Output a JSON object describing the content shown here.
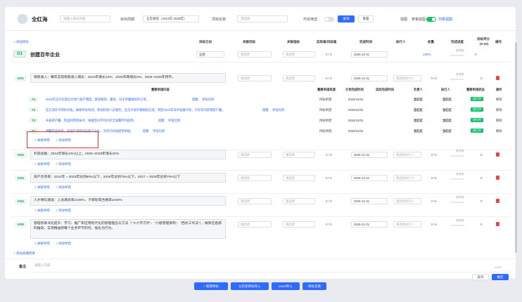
{
  "filter": {
    "user": "全红海",
    "search_placeholder": "请输入目标内容",
    "period_label": "目标周期",
    "period_value": "五年规划（2024年-2028年）",
    "project_label": "项目名称",
    "project_placeholder": "请选择",
    "open_label": "开启筛选",
    "query_btn": "查询",
    "reset_btn": "重置",
    "view_label": "视图",
    "table_view_label": "表格视图",
    "list_view_label": "列表视图"
  },
  "table": {
    "add_objective_link": "+ 添加目标",
    "headers": {
      "direction": "目标方向",
      "related_goal": "关联目标",
      "related_indicator": "关联指标",
      "actual_target": "实际值/目标值",
      "deadline": "完成时间",
      "executor": "执行人",
      "weight": "权重",
      "progress": "完成进度",
      "self_score_l1": "目标评分",
      "self_score_l2": "(0-10)",
      "ops": "操作"
    }
  },
  "objective": {
    "tag": "O1",
    "title": "创建百年企业",
    "direction": "业绩",
    "related_goal_ph": "请选择",
    "related_indicator_ph": "请选择",
    "actual_target": "0 / 0",
    "deadline": "2026-12-31",
    "weight": "100%",
    "progress_pill": "未完成",
    "score": "0"
  },
  "krs": [
    {
      "tag": "KR1",
      "text": "销售收入：每年实现销售收入增长：2024年增长10%、2025年再增长5%、2026~2028年持平。",
      "goal_ph": "请选择",
      "indicator_ph": "请选择",
      "actual": "0 / 0",
      "deadline": "2026-12-31",
      "executor_ph": "请选择执行人",
      "weight": "0 %",
      "pill": "未完成",
      "score": "0"
    },
    {
      "tag": "KR2",
      "text": "利润总额：2024年增长10%以上，2025~2028年增长20%",
      "goal_ph": "请选择",
      "indicator_ph": "请选择",
      "actual": "0 / 0",
      "deadline": "2026-12-31",
      "executor_ph": "请选择执行人",
      "weight": "0 %",
      "pill": "未完成",
      "score": "0"
    },
    {
      "tag": "KR3",
      "text": "资产负债率：2024年 ~ 2025年达到80%以下，2026年达到75%以下，2027 ~ 2028年达到70%以下",
      "goal_ph": "请选择",
      "indicator_ph": "请选择",
      "actual": "0 / 0",
      "deadline": "2026-12-31",
      "executor_ph": "请选择执行人",
      "weight": "0 %",
      "pill": "未完成",
      "score": "0"
    },
    {
      "tag": "KR4",
      "text": "人才梯队建设：人员满员率≥100%、干部轮岗合格率≥100%",
      "goal_ph": "请选择",
      "indicator_ph": "请选择",
      "actual": "0 / 0",
      "deadline": "2026-12-31",
      "executor_ph": "请选择执行人",
      "weight": "0 %",
      "pill": "未完成",
      "score": "0"
    },
    {
      "tag": "KR5",
      "text": "管理改革深化提升：学习、推广和应用现代化的管理理念与方法（\"十六字方针\"、\"六级管理架构\"、\"西优工作法\"），做到在各部的推动、实现精益到每个业务环节的内，强化为行为。",
      "goal_ph": "请选择",
      "indicator_ph": "请选择",
      "actual": "0 / 0",
      "deadline": "2026-12-31",
      "executor_ph": "请选择执行人",
      "weight": "0 %",
      "pill": "未完成",
      "score": "0"
    }
  ],
  "kr_links": {
    "add_plan": "+ 关联举措",
    "add_todo": "+ 添加举措"
  },
  "tasks_header": {
    "content": "重要举措内容",
    "source": "重要举措来源",
    "plan_time": "计划完成时间",
    "actual_time": "实际完成时间",
    "owner": "负责人",
    "executor": "执行人",
    "status": "重要举措状态",
    "ops": "操作"
  },
  "tasks": [
    {
      "tag": "T1",
      "content": "2024年应付实现应付进行按产需度，跌周推荐，最高，对于单量规划的订单。",
      "edit": "提醒",
      "evaluate": "评估比例",
      "source": "目标举措",
      "plan": "2024/12/31",
      "owner": "全红红",
      "executor": "全红红",
      "status": "进行中",
      "op": "移除"
    },
    {
      "tag": "T2",
      "content": "区先海外市场的开拓，确保目标利润，新加利润人员服务，区先开发外额规划方案，制定2024年海外拓展计划，力争年内新增客户量。",
      "edit": "提醒",
      "evaluate": "评估比例",
      "source": "目标举措",
      "plan": "2024/12/31",
      "owner": "全红红",
      "executor": "全红红",
      "status": "进行中",
      "op": "移除"
    },
    {
      "tag": "T3",
      "content": "开拓新产量，新品利用新技术，依据年内平均约年全国量平均提供，",
      "edit": "提醒",
      "evaluate": "评估比例",
      "source": "目标举措",
      "plan": "2024/12/31",
      "owner": "全红红",
      "executor": "全红红",
      "status": "进行中",
      "op": "移除"
    },
    {
      "tag": "T4",
      "content": "调整新品体系，加强市场研究技能工企业，为年内开拓提供依据。",
      "edit": "提醒",
      "evaluate": "评估比例",
      "source": "目标举措",
      "plan": "2024/12/31",
      "owner": "全红红",
      "executor": "全红红",
      "status": "进行中",
      "op": "移除"
    }
  ],
  "add_kr_link": "+ 添加关键结果",
  "remark": {
    "label": "备注",
    "placeholder": "请输入内容",
    "counter": "0/500"
  },
  "actions": {
    "cancel": "取消",
    "confirm": "确定"
  },
  "footer": {
    "add_goal": "+ 新建目标",
    "import_goal": "从历史目标导入",
    "excel_import": "excel导入",
    "goal_cloud": "目标云盘"
  }
}
